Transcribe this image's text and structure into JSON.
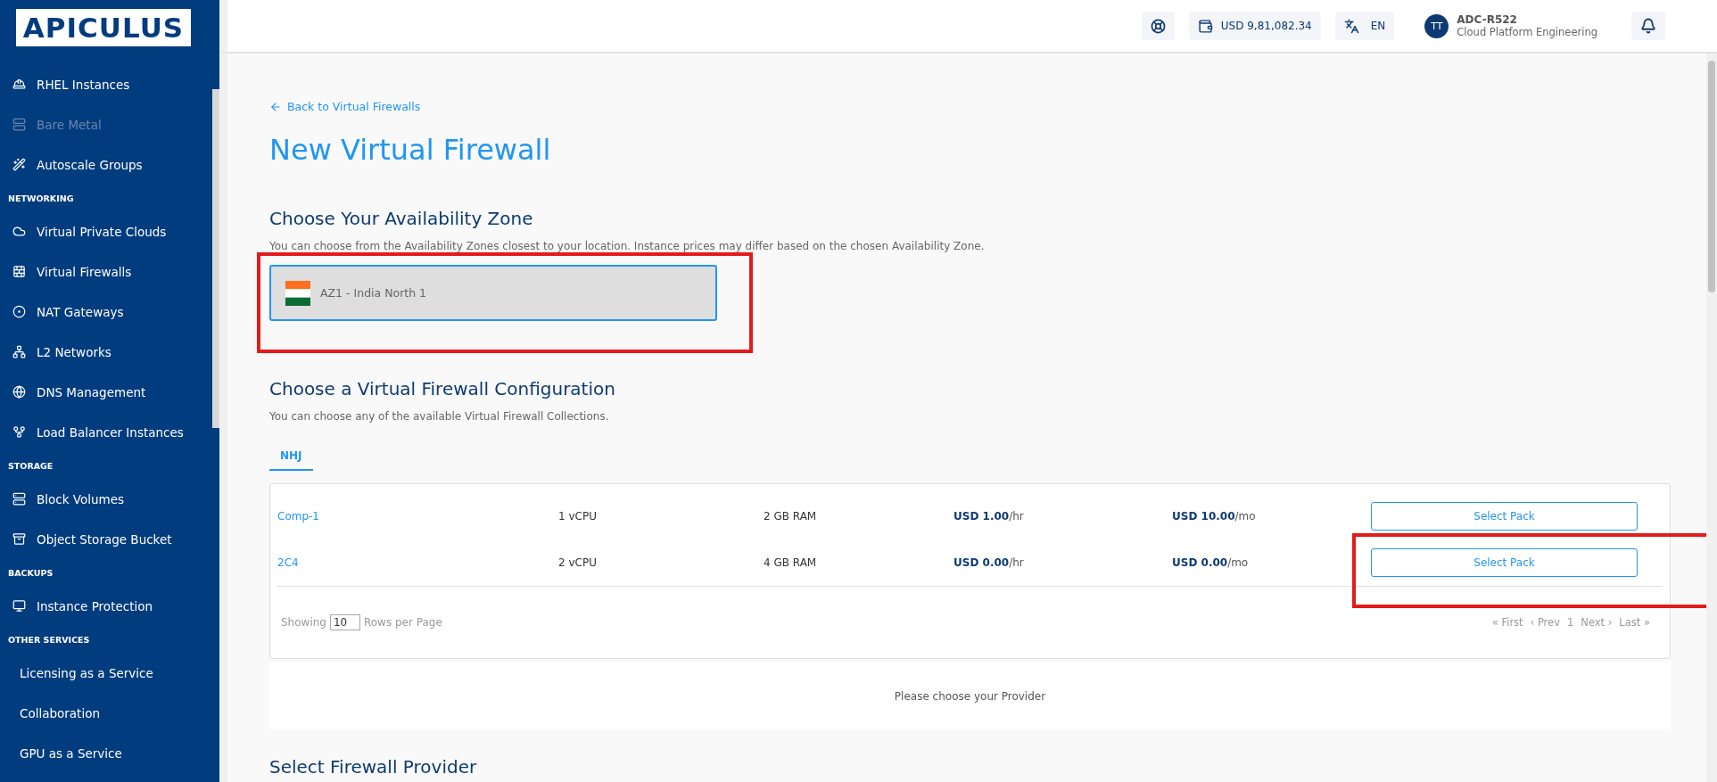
{
  "brand": {
    "logo": "APICULUS"
  },
  "sidebar": {
    "items": [
      {
        "kind": "item",
        "label": "RHEL Instances",
        "disabled": false
      },
      {
        "kind": "item",
        "label": "Bare Metal",
        "disabled": true
      },
      {
        "kind": "item",
        "label": "Autoscale Groups",
        "disabled": false
      },
      {
        "kind": "section",
        "label": "NETWORKING"
      },
      {
        "kind": "item",
        "label": "Virtual Private Clouds",
        "disabled": false
      },
      {
        "kind": "item",
        "label": "Virtual Firewalls",
        "disabled": false
      },
      {
        "kind": "item",
        "label": "NAT Gateways",
        "disabled": false
      },
      {
        "kind": "item",
        "label": "L2 Networks",
        "disabled": false
      },
      {
        "kind": "item",
        "label": "DNS Management",
        "disabled": false
      },
      {
        "kind": "item",
        "label": "Load Balancer Instances",
        "disabled": false
      },
      {
        "kind": "section",
        "label": "STORAGE"
      },
      {
        "kind": "item",
        "label": "Block Volumes",
        "disabled": false
      },
      {
        "kind": "item",
        "label": "Object Storage Bucket",
        "disabled": false
      },
      {
        "kind": "section",
        "label": "BACKUPS"
      },
      {
        "kind": "item",
        "label": "Instance Protection",
        "disabled": false
      },
      {
        "kind": "section",
        "label": "OTHER SERVICES"
      },
      {
        "kind": "item",
        "label": "Licensing as a Service",
        "disabled": false
      },
      {
        "kind": "item",
        "label": "Collaboration",
        "disabled": false
      },
      {
        "kind": "item",
        "label": "GPU as a Service",
        "disabled": false
      }
    ]
  },
  "topbar": {
    "balance": "USD 9,81,082.34",
    "language": "EN",
    "user": {
      "initials": "TT",
      "name": "ADC-R522",
      "org": "Cloud Platform Engineering"
    }
  },
  "back_link": "Back to Virtual Firewalls",
  "title": "New Virtual Firewall",
  "zone_section": {
    "heading": "Choose Your Availability Zone",
    "description": "You can choose from the Availability Zones closest to your location. Instance prices may differ based on the chosen Availability Zone.",
    "zones": [
      {
        "label": "AZ1 - India North 1",
        "selected": true,
        "highlighted": true
      }
    ]
  },
  "config_section": {
    "heading": "Choose a Virtual Firewall Configuration",
    "description": "You can choose any of the available Virtual Firewall Collections.",
    "tabs": [
      {
        "label": "NHJ",
        "selected": true
      }
    ],
    "rows": [
      {
        "name": "Comp-1",
        "cpu": "1 vCPU",
        "ram": "2 GB RAM",
        "hourly_price": "USD 1.00",
        "hourly_unit": "/hr",
        "monthly_price": "USD 10.00",
        "monthly_unit": "/mo",
        "button": "Select Pack",
        "highlighted": false
      },
      {
        "name": "2C4",
        "cpu": "2 vCPU",
        "ram": "4 GB RAM",
        "hourly_price": "USD 0.00",
        "hourly_unit": "/hr",
        "monthly_price": "USD 0.00",
        "monthly_unit": "/mo",
        "button": "Select Pack",
        "highlighted": true
      }
    ],
    "footer": {
      "showing": "Showing",
      "rows_value": "10",
      "rows_per_page": "Rows per Page",
      "pager": [
        {
          "label": "« First"
        },
        {
          "label": "‹ Prev"
        },
        {
          "label": "1"
        },
        {
          "label": "Next ›"
        },
        {
          "label": "Last »"
        }
      ]
    }
  },
  "provider_notice": "Please choose your Provider",
  "provider_heading": "Select Firewall Provider"
}
